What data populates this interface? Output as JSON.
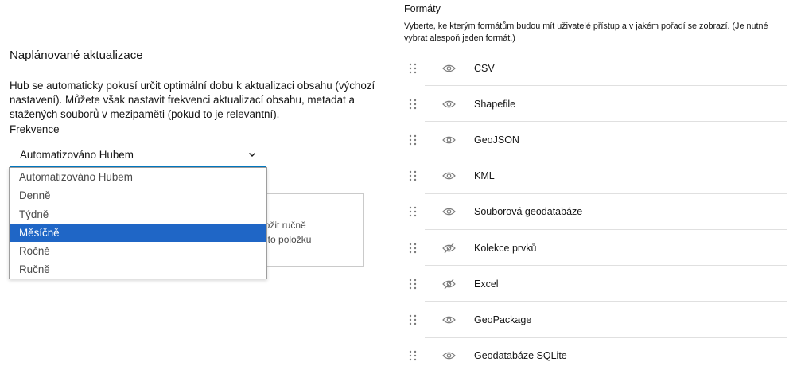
{
  "scheduled_updates": {
    "title": "Naplánované aktualizace",
    "description": "Hub se automaticky pokusí určit optimální dobu k aktualizaci obsahu (výchozí nastavení). Můžete však nastavit frekvenci aktualizací obsahu, metadat a stažených souborů v mezipaměti (pokud to je relevantní).",
    "frequency_label": "Frekvence",
    "selected_value": "Automatizováno Hubem",
    "options": [
      "Automatizováno Hubem",
      "Denně",
      "Týdně",
      "Měsíčně",
      "Ročně",
      "Ručně"
    ],
    "highlighted_option": "Měsíčně",
    "obscured_text_line1": "ložit ručně",
    "obscured_text_line2": "uto položku"
  },
  "formats": {
    "title": "Formáty",
    "description": "Vyberte, ke kterým formátům budou mít uživatelé přístup a v jakém pořadí se zobrazí. (Je nutné vybrat alespoň jeden formát.)",
    "items": [
      {
        "label": "CSV",
        "visible": true
      },
      {
        "label": "Shapefile",
        "visible": true
      },
      {
        "label": "GeoJSON",
        "visible": true
      },
      {
        "label": "KML",
        "visible": true
      },
      {
        "label": "Souborová geodatabáze",
        "visible": true
      },
      {
        "label": "Kolekce prvků",
        "visible": false
      },
      {
        "label": "Excel",
        "visible": false
      },
      {
        "label": "GeoPackage",
        "visible": true
      },
      {
        "label": "Geodatabáze SQLite",
        "visible": true
      }
    ]
  },
  "icons": {
    "drag": "drag-handle-icon",
    "visible": "eye-icon",
    "hidden": "eye-off-icon",
    "dropdown": "chevron-down-icon"
  },
  "colors": {
    "accent": "#0079c1",
    "highlight": "#1f66c6",
    "icon": "#7a7a7a"
  }
}
